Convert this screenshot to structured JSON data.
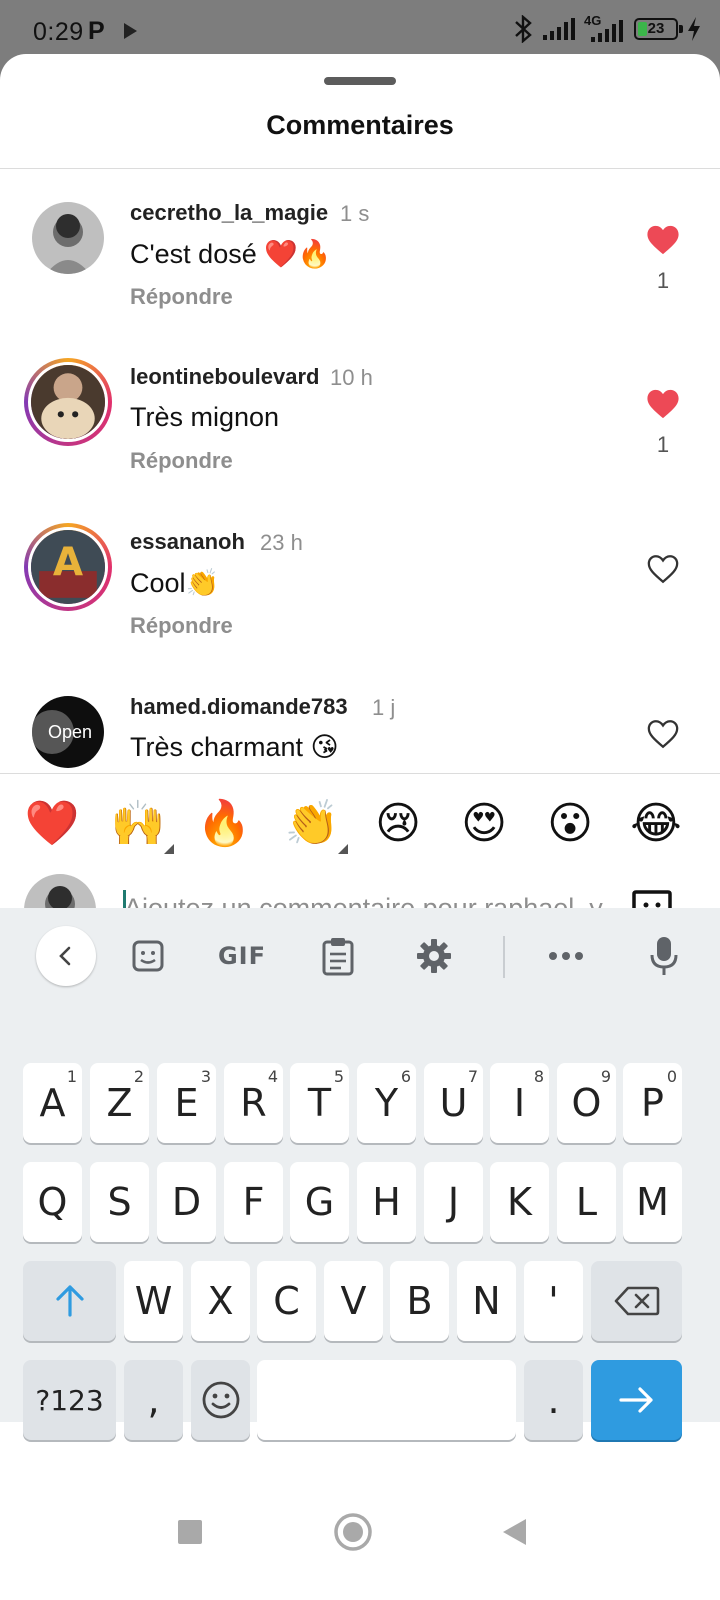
{
  "status_bar": {
    "time": "0:29",
    "app_letter": "P",
    "network": "4G",
    "battery_level": "23",
    "battery_fraction": 0.23,
    "battery_color": "#3bb54a",
    "icons": [
      "play-icon",
      "bluetooth-icon",
      "signal-icon",
      "charging-icon"
    ]
  },
  "sheet": {
    "title": "Commentaires"
  },
  "comments": [
    {
      "username": "cecretho_la_magie",
      "time": "1 s",
      "text": "C'est dosé ❤️🔥",
      "reply": "Répondre",
      "liked": true,
      "likes": "1"
    },
    {
      "username": "leontineboulevard",
      "time": "10 h",
      "text": "Très mignon",
      "reply": "Répondre",
      "liked": true,
      "likes": "1"
    },
    {
      "username": "essananoh",
      "time": "23 h",
      "text": "Cool👏",
      "reply": "Répondre",
      "liked": false,
      "likes": ""
    },
    {
      "username": "hamed.diomande783",
      "time": "1 j",
      "text": "Très charmant 😘",
      "reply": "",
      "liked": false,
      "likes": ""
    }
  ],
  "avatar_texts": {
    "open_logo": "Open",
    "story_letter": "A"
  },
  "reactions": [
    "❤️",
    "🙌",
    "🔥",
    "👏",
    "😢",
    "😍",
    "😮",
    "😂"
  ],
  "composer": {
    "placeholder": "Ajoutez un commentaire pour raphael_y",
    "value": ""
  },
  "keyboard": {
    "toolbar": {
      "gif_label": "GIF",
      "icons": [
        "chevron-left-icon",
        "sticker-icon",
        "gif-icon",
        "clipboard-icon",
        "gear-icon",
        "more-icon",
        "microphone-icon"
      ]
    },
    "row1": [
      {
        "k": "A",
        "h": "1"
      },
      {
        "k": "Z",
        "h": "2"
      },
      {
        "k": "E",
        "h": "3"
      },
      {
        "k": "R",
        "h": "4"
      },
      {
        "k": "T",
        "h": "5"
      },
      {
        "k": "Y",
        "h": "6"
      },
      {
        "k": "U",
        "h": "7"
      },
      {
        "k": "I",
        "h": "8"
      },
      {
        "k": "O",
        "h": "9"
      },
      {
        "k": "P",
        "h": "0"
      }
    ],
    "row2": [
      "Q",
      "S",
      "D",
      "F",
      "G",
      "H",
      "J",
      "K",
      "L",
      "M"
    ],
    "row3": [
      "W",
      "X",
      "C",
      "V",
      "B",
      "N",
      "'"
    ],
    "symbols_label": "?123",
    "comma": ",",
    "period": ".",
    "accent_color": "#2f9be0"
  },
  "colors": {
    "like_red": "#ed4956",
    "muted_text": "#8e8e8e"
  }
}
